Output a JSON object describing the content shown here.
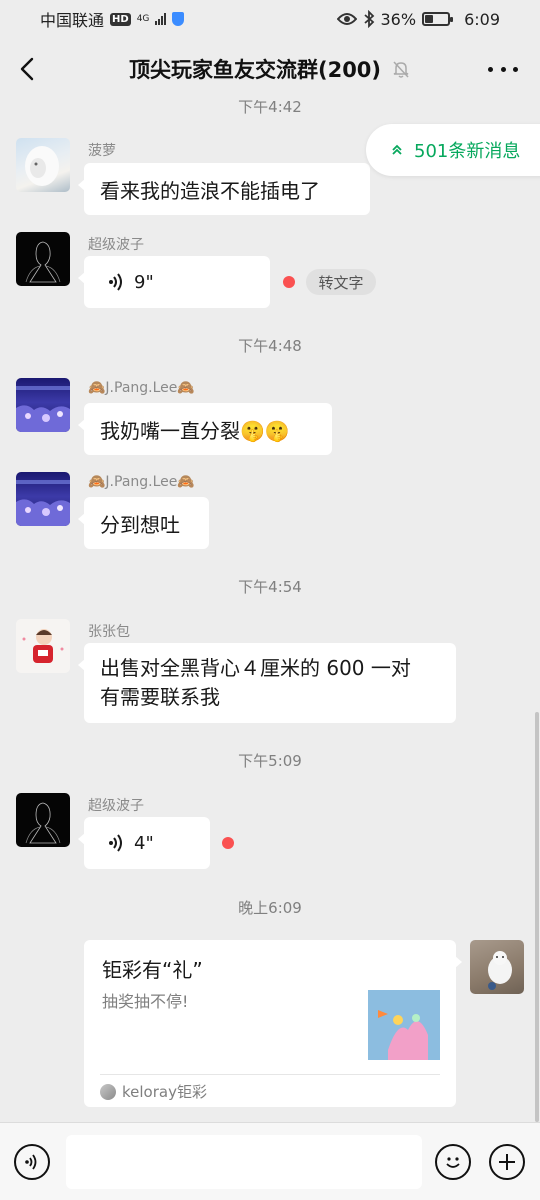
{
  "status_bar": {
    "carrier": "中国联通",
    "hd": "HD",
    "net": "4G",
    "battery": "36%",
    "battery_level": 0.36,
    "time": "6:09"
  },
  "header": {
    "title": "顶尖玩家鱼友交流群(200)",
    "muted": true
  },
  "new_messages": "501条新消息",
  "times": {
    "t1": "下午4:42",
    "t2": "下午4:48",
    "t3": "下午4:54",
    "t4": "下午5:09",
    "t5": "晚上6:09"
  },
  "messages": {
    "m1": {
      "sender": "菠萝",
      "text": "看来我的造浪不能插电了"
    },
    "m2": {
      "sender": "超级波子",
      "duration": "9\"",
      "transcribe": "转文字"
    },
    "m3": {
      "sender": "🙈J.Pang.Lee🙈",
      "text": "我奶嘴一直分裂🤫🤫"
    },
    "m4": {
      "sender": "🙈J.Pang.Lee🙈",
      "text": "分到想吐"
    },
    "m5": {
      "sender": "张张包",
      "line1": "出售对全黑背心４厘米的 600 一对",
      "line2": "有需要联系我"
    },
    "m6": {
      "sender": "超级波子",
      "duration": "4\""
    },
    "m7": {
      "title": "钜彩有“礼”",
      "desc": "抽奖抽不停!",
      "source": "keloray钜彩"
    }
  },
  "input": {
    "value": "",
    "placeholder": ""
  },
  "colors": {
    "accent_green": "#07a85d",
    "unread_red": "#fa5151",
    "background": "#ededed"
  }
}
